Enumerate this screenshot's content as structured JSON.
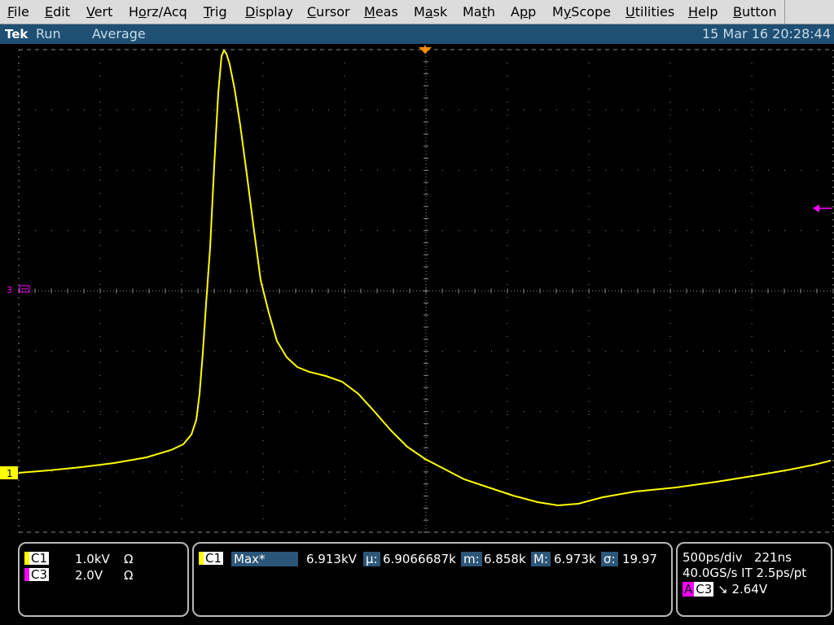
{
  "menu": {
    "items": [
      {
        "pre": "",
        "ul": "F",
        "post": "ile"
      },
      {
        "pre": "",
        "ul": "E",
        "post": "dit"
      },
      {
        "pre": "",
        "ul": "V",
        "post": "ert"
      },
      {
        "pre": "H",
        "ul": "o",
        "post": "rz/Acq"
      },
      {
        "pre": "",
        "ul": "T",
        "post": "rig"
      },
      {
        "pre": "",
        "ul": "D",
        "post": "isplay"
      },
      {
        "pre": "",
        "ul": "C",
        "post": "ursor"
      },
      {
        "pre": "",
        "ul": "M",
        "post": "eas"
      },
      {
        "pre": "M",
        "ul": "a",
        "post": "sk"
      },
      {
        "pre": "Ma",
        "ul": "t",
        "post": "h"
      },
      {
        "pre": "A",
        "ul": "p",
        "post": "p"
      },
      {
        "pre": "M",
        "ul": "y",
        "post": "Scope"
      },
      {
        "pre": "",
        "ul": "U",
        "post": "tilities"
      },
      {
        "pre": "",
        "ul": "H",
        "post": "elp"
      },
      {
        "pre": "",
        "ul": "B",
        "post": "utton"
      }
    ]
  },
  "status": {
    "brand": "Tek",
    "run_state": "Run",
    "mode": "Average",
    "timestamp": "15 Mar 16 20:28:44"
  },
  "markers": {
    "ch3_ref": "3",
    "ch1_ref": "1"
  },
  "colors": {
    "ch1": "#ffff00",
    "ch3": "#ff00ff",
    "trigger": "#ff8c00",
    "grid": "#8a8a8a",
    "status_bg": "#1f4f73",
    "highlight": "#2c5678"
  },
  "channels": [
    {
      "name": "C1",
      "scale": "1.0kV",
      "coupling": "Ω"
    },
    {
      "name": "C3",
      "scale": "2.0V",
      "coupling": "Ω"
    }
  ],
  "measurement": {
    "channel": "C1",
    "type": "Max*",
    "value": "6.913kV",
    "mean_label": "µ:",
    "mean": "6.9066687k",
    "min_label": "m:",
    "min": "6.858k",
    "max_label": "M:",
    "max": "6.973k",
    "sigma_label": "σ:",
    "sigma": "19.97"
  },
  "timebase": {
    "scale": "500ps/div",
    "delay": "221ns",
    "sample_rate": "40.0GS/s IT 2.5ps/pt",
    "trigger_label": "A",
    "trigger_source": "C3",
    "trigger_slope": "↘",
    "trigger_level": "2.64V"
  }
}
